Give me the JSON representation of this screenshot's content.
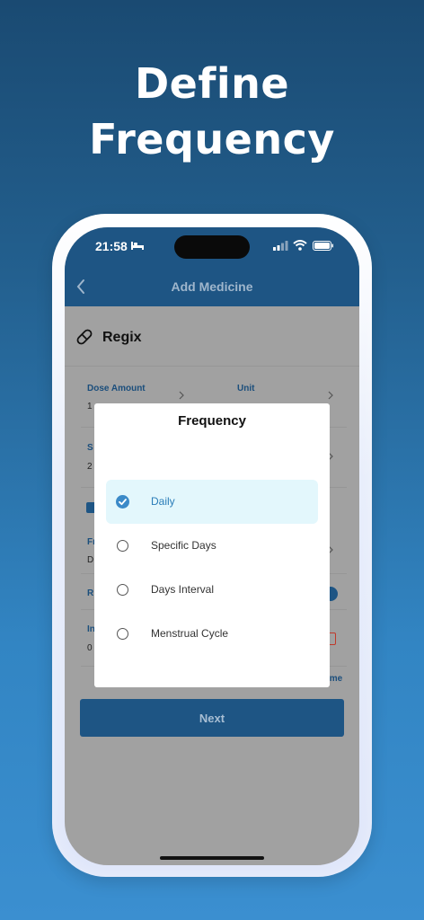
{
  "headline": {
    "line1": "Define",
    "line2": "Frequency"
  },
  "status_bar": {
    "time": "21:58"
  },
  "appbar": {
    "title": "Add Medicine"
  },
  "medicine": {
    "name": "Regix"
  },
  "form": {
    "dose_amount_label": "Dose Amount",
    "dose_amount_value": "1",
    "unit_label": "Unit",
    "row2_label_partial": "S",
    "row2_value_partial": "2",
    "frequency_label_partial": "Fr",
    "frequency_value_partial": "D",
    "row4_label_partial": "R",
    "row5_label_partial": "In",
    "row5_value_partial": "0",
    "add_time_partial": "ime"
  },
  "next_button": {
    "label": "Next"
  },
  "dialog": {
    "title": "Frequency",
    "options": [
      {
        "label": "Daily",
        "selected": true
      },
      {
        "label": "Specific Days",
        "selected": false
      },
      {
        "label": "Days Interval",
        "selected": false
      },
      {
        "label": "Menstrual Cycle",
        "selected": false
      }
    ]
  },
  "colors": {
    "primary": "#1e5584",
    "selected_bg": "#e3f7fc",
    "selected_text": "#2a7db8"
  }
}
